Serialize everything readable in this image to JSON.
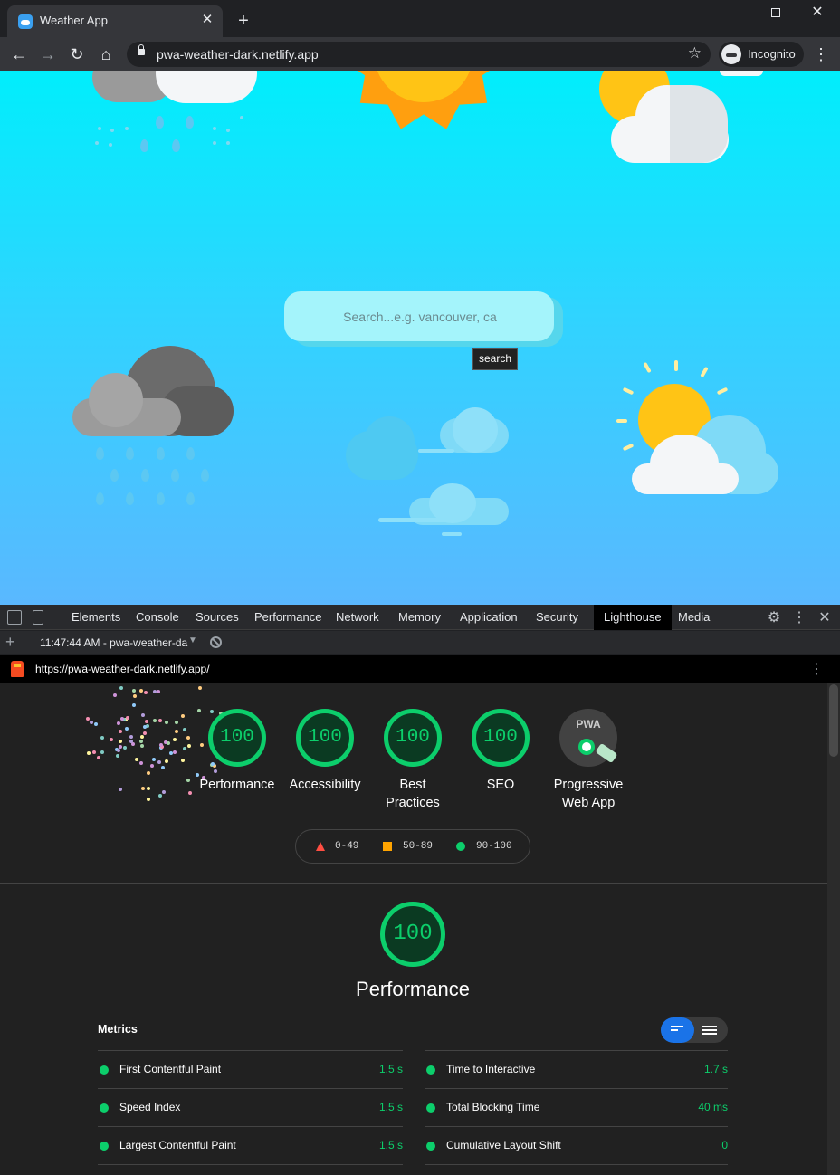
{
  "browser": {
    "tab_title": "Weather App",
    "url": "pwa-weather-dark.netlify.app",
    "incognito_label": "Incognito"
  },
  "page": {
    "search_placeholder": "Search...e.g. vancouver, ca",
    "search_button": "search"
  },
  "devtools": {
    "tabs": [
      "Elements",
      "Console",
      "Sources",
      "Performance",
      "Network",
      "Memory",
      "Application",
      "Security",
      "Lighthouse",
      "Media"
    ],
    "active_tab": "Lighthouse",
    "report_time": "11:47:44 AM - pwa-weather-da",
    "audited_url": "https://pwa-weather-dark.netlify.app/"
  },
  "lighthouse": {
    "categories": [
      {
        "score": "100",
        "label": "Performance"
      },
      {
        "score": "100",
        "label": "Accessibility"
      },
      {
        "score": "100",
        "label": "Best Practices"
      },
      {
        "score": "100",
        "label": "SEO"
      }
    ],
    "pwa_badge": "PWA",
    "pwa_label": "Progressive Web App",
    "legend": [
      "0-49",
      "50-89",
      "90-100"
    ],
    "legend_colors": [
      "#ff4e42",
      "#ffa400",
      "#0cce6b"
    ],
    "section_score": "100",
    "section_title": "Performance",
    "metrics_title": "Metrics",
    "metrics_left": [
      {
        "name": "First Contentful Paint",
        "value": "1.5 s"
      },
      {
        "name": "Speed Index",
        "value": "1.5 s"
      },
      {
        "name": "Largest Contentful Paint",
        "value": "1.5 s"
      }
    ],
    "metrics_right": [
      {
        "name": "Time to Interactive",
        "value": "1.7 s"
      },
      {
        "name": "Total Blocking Time",
        "value": "40 ms"
      },
      {
        "name": "Cumulative Layout Shift",
        "value": "0"
      }
    ]
  }
}
